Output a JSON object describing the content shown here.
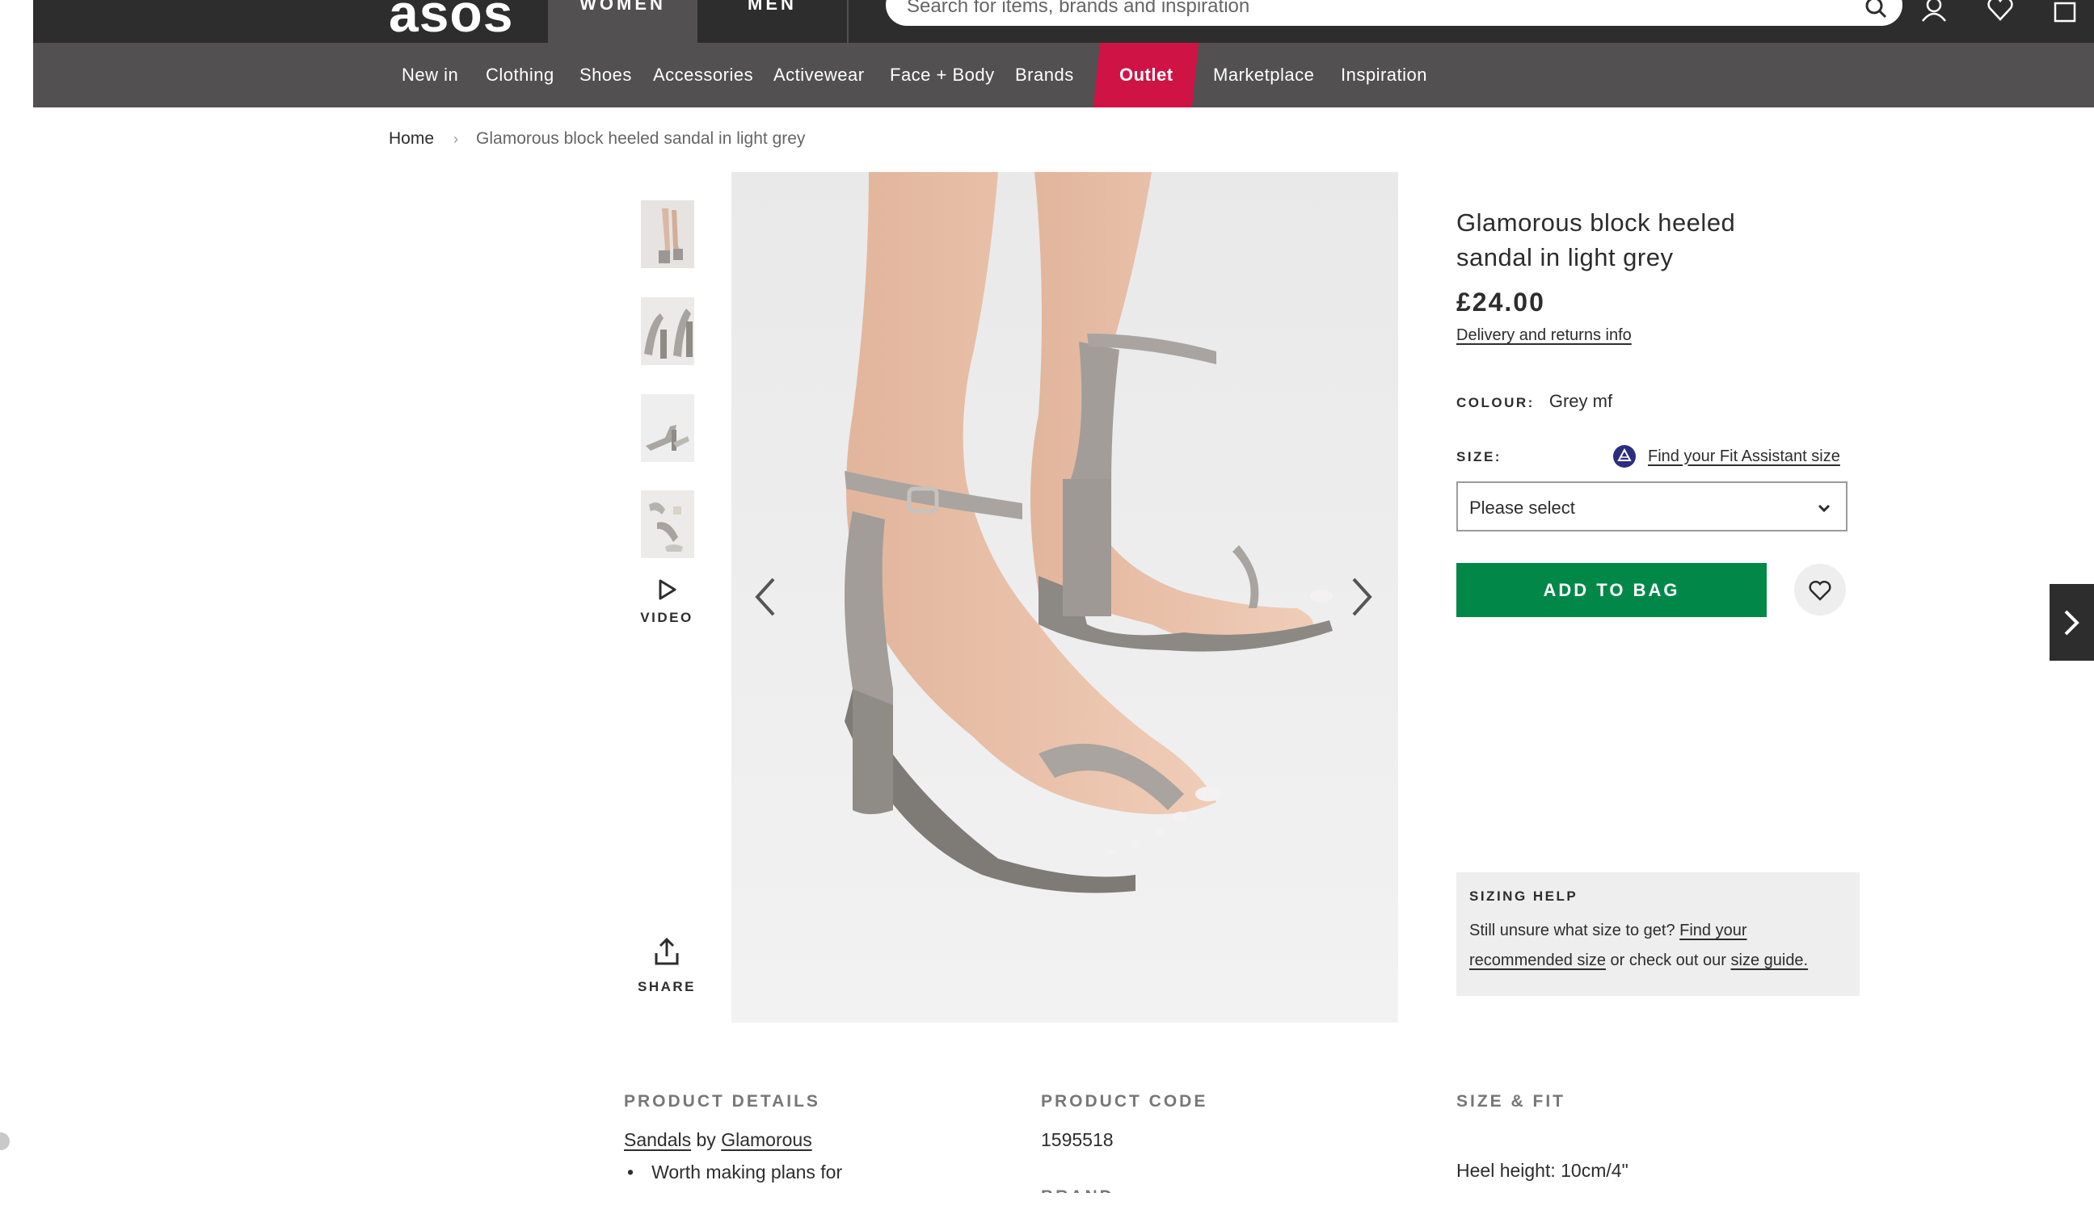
{
  "header": {
    "logo": "asos",
    "tabs": [
      "WOMEN",
      "MEN"
    ],
    "search_placeholder": "Search for items, brands and inspiration",
    "icons": [
      "account-icon",
      "heart-icon",
      "bag-icon"
    ]
  },
  "nav": {
    "items": [
      "New in",
      "Clothing",
      "Shoes",
      "Accessories",
      "Activewear",
      "Face + Body",
      "Brands",
      "Outlet",
      "Marketplace",
      "Inspiration"
    ],
    "highlight_color": "#d01345"
  },
  "breadcrumb": {
    "home": "Home",
    "separator": "›",
    "current": "Glamorous block heeled sandal in light grey"
  },
  "gallery": {
    "video_label": "VIDEO",
    "share_label": "SHARE"
  },
  "product": {
    "title": "Glamorous block heeled sandal in light grey",
    "price": "£24.00",
    "delivery_link": "Delivery and returns info",
    "colour_label": "COLOUR:",
    "colour_value": "Grey mf",
    "size_label": "SIZE:",
    "fit_assistant_link": "Find your Fit Assistant size",
    "size_select_value": "Please select",
    "add_to_bag": "ADD TO BAG",
    "add_to_bag_color": "#018849"
  },
  "sizing_help": {
    "heading": "SIZING HELP",
    "text_before": "Still unsure what size to get? ",
    "link1": "Find your recommended size",
    "text_middle": " or check out our ",
    "link2": "size guide."
  },
  "details": {
    "product_details_heading": "PRODUCT DETAILS",
    "category_link": "Sandals",
    "by_text": " by ",
    "brand_link": "Glamorous",
    "bullet": "Worth making plans for",
    "product_code_heading": "PRODUCT CODE",
    "product_code": "1595518",
    "brand_heading": "BRAND",
    "size_fit_heading": "SIZE & FIT",
    "heel_height": "Heel height: 10cm/4\""
  }
}
